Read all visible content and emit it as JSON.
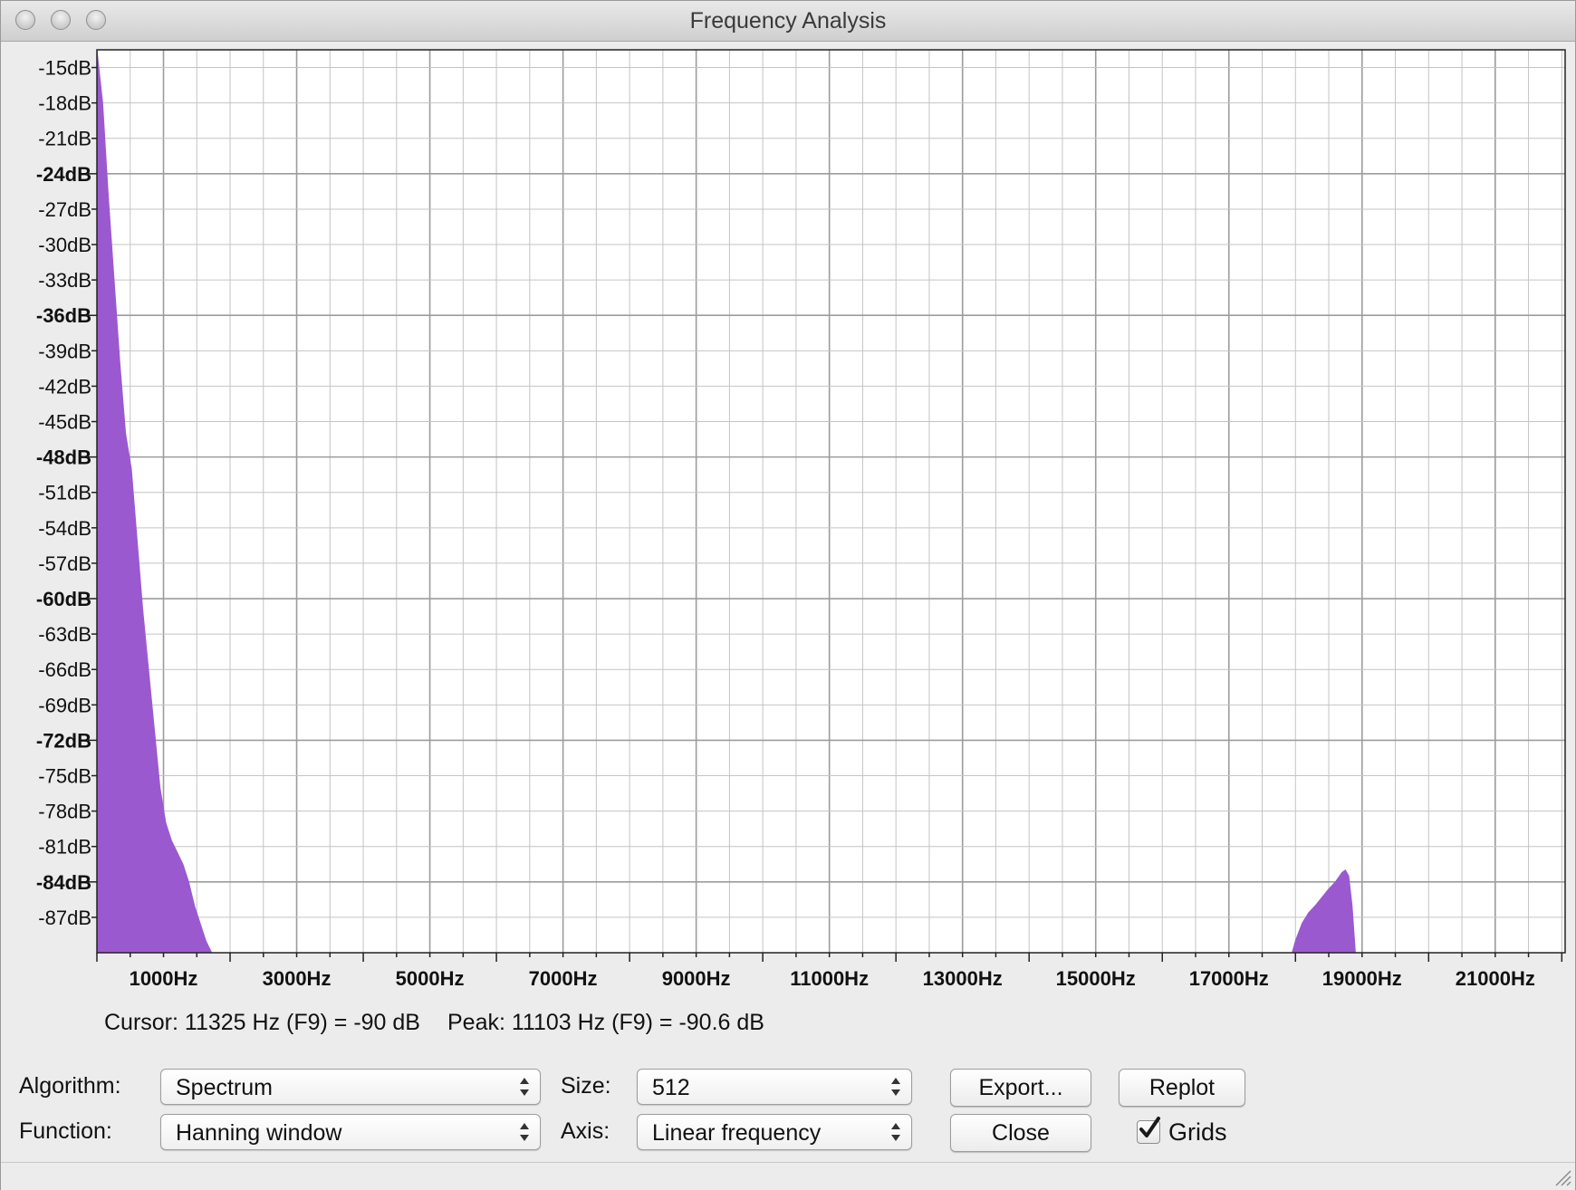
{
  "window": {
    "title": "Frequency Analysis"
  },
  "chart_data": {
    "type": "area",
    "title": "",
    "xlabel": "",
    "ylabel": "",
    "x_unit": "Hz",
    "y_unit": "dB",
    "xlim": [
      0,
      22050
    ],
    "ylim": [
      -90,
      -13.5
    ],
    "grid": true,
    "color": "#9b59cf",
    "x_tick_labels": [
      "1000Hz",
      "3000Hz",
      "5000Hz",
      "7000Hz",
      "9000Hz",
      "11000Hz",
      "13000Hz",
      "15000Hz",
      "17000Hz",
      "19000Hz",
      "21000Hz"
    ],
    "x_ticks": [
      1000,
      3000,
      5000,
      7000,
      9000,
      11000,
      13000,
      15000,
      17000,
      19000,
      21000
    ],
    "y_tick_labels": [
      "-15dB",
      "-18dB",
      "-21dB",
      "-24dB",
      "-27dB",
      "-30dB",
      "-33dB",
      "-36dB",
      "-39dB",
      "-42dB",
      "-45dB",
      "-48dB",
      "-51dB",
      "-54dB",
      "-57dB",
      "-60dB",
      "-63dB",
      "-66dB",
      "-69dB",
      "-72dB",
      "-75dB",
      "-78dB",
      "-81dB",
      "-84dB",
      "-87dB"
    ],
    "y_ticks": [
      -15,
      -18,
      -21,
      -24,
      -27,
      -30,
      -33,
      -36,
      -39,
      -42,
      -45,
      -48,
      -51,
      -54,
      -57,
      -60,
      -63,
      -66,
      -69,
      -72,
      -75,
      -78,
      -81,
      -84,
      -87
    ],
    "y_major_ticks": [
      -24,
      -36,
      -48,
      -60,
      -72,
      -84
    ],
    "series": [
      {
        "x": [
          0,
          86,
          172,
          258,
          344,
          430,
          517,
          603,
          689,
          775,
          861,
          947,
          1034,
          1120,
          1206,
          1292,
          1378,
          1464,
          1550,
          1637,
          1723,
          1800
        ],
        "y": [
          -13,
          -18,
          -26,
          -33,
          -40,
          -46,
          -49,
          -55,
          -61,
          -66,
          -71,
          -76,
          -79,
          -80.5,
          -81.5,
          -82.5,
          -84,
          -86,
          -87.5,
          -89,
          -90,
          -90
        ]
      },
      {
        "x": [
          17950,
          18000,
          18100,
          18200,
          18300,
          18400,
          18500,
          18600,
          18700,
          18750,
          18800,
          18850,
          18900
        ],
        "y": [
          -90,
          -89,
          -87.5,
          -86.6,
          -86,
          -85.3,
          -84.6,
          -84,
          -83.2,
          -83,
          -83.5,
          -86,
          -90
        ]
      }
    ]
  },
  "status": {
    "cursor": "Cursor: 11325 Hz (F9) = -90 dB",
    "peak": "Peak: 11103 Hz (F9) = -90.6 dB"
  },
  "controls": {
    "algorithm_label": "Algorithm:",
    "algorithm_value": "Spectrum",
    "function_label": "Function:",
    "function_value": "Hanning window",
    "size_label": "Size:",
    "size_value": "512",
    "axis_label": "Axis:",
    "axis_value": "Linear frequency",
    "export_label": "Export...",
    "replot_label": "Replot",
    "close_label": "Close",
    "grids_label": "Grids",
    "grids_checked": true
  }
}
